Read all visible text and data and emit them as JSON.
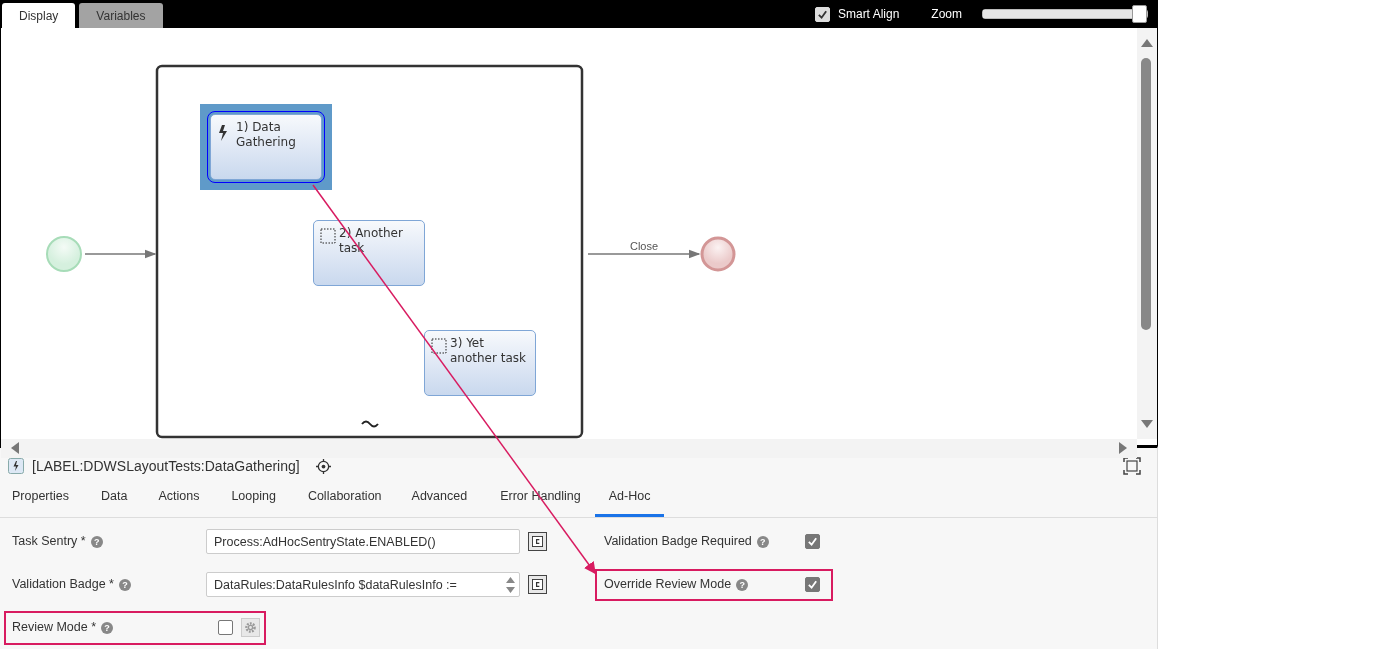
{
  "tabs": [
    {
      "label": "Display",
      "selected": true
    },
    {
      "label": "Variables",
      "selected": false
    }
  ],
  "smart_align": {
    "label": "Smart Align",
    "checked": true
  },
  "zoom": {
    "label": "Zoom",
    "level": 1.0
  },
  "diagram": {
    "tasks": [
      {
        "label": "1) Data Gathering",
        "kind": "triggered",
        "selected": true
      },
      {
        "label": "2) Another task",
        "kind": "plain",
        "selected": false
      },
      {
        "label": "3) Yet another task",
        "kind": "plain",
        "selected": false
      }
    ],
    "end_flow_label": "Close"
  },
  "selected_element": {
    "title": "[LABEL:DDWSLayoutTests:DataGathering]"
  },
  "property_tabs": [
    {
      "label": "Properties",
      "selected": false
    },
    {
      "label": "Data",
      "selected": false
    },
    {
      "label": "Actions",
      "selected": false
    },
    {
      "label": "Looping",
      "selected": false
    },
    {
      "label": "Collaboration",
      "selected": false
    },
    {
      "label": "Advanced",
      "selected": false
    },
    {
      "label": "Error Handling",
      "selected": false
    },
    {
      "label": "Ad-Hoc",
      "selected": true
    }
  ],
  "left_fields": [
    {
      "label": "Task Sentry *",
      "help": "?",
      "kind": "text",
      "value": "Process:AdHocSentryState.ENABLED()",
      "highlighted": false
    },
    {
      "label": "Validation Badge *",
      "help": "?",
      "kind": "textarea",
      "value": "DataRules:DataRulesInfo $dataRulesInfo :=",
      "highlighted": false
    },
    {
      "label": "Review Mode *",
      "help": "?",
      "kind": "checkbox",
      "checked": false,
      "highlighted": true
    }
  ],
  "right_fields": [
    {
      "label": "Validation Badge Required",
      "help": "?",
      "kind": "checkbox",
      "checked": true,
      "highlighted": false
    },
    {
      "label": "Override Review Mode",
      "help": "?",
      "kind": "checkbox",
      "checked": true,
      "highlighted": true
    }
  ]
}
